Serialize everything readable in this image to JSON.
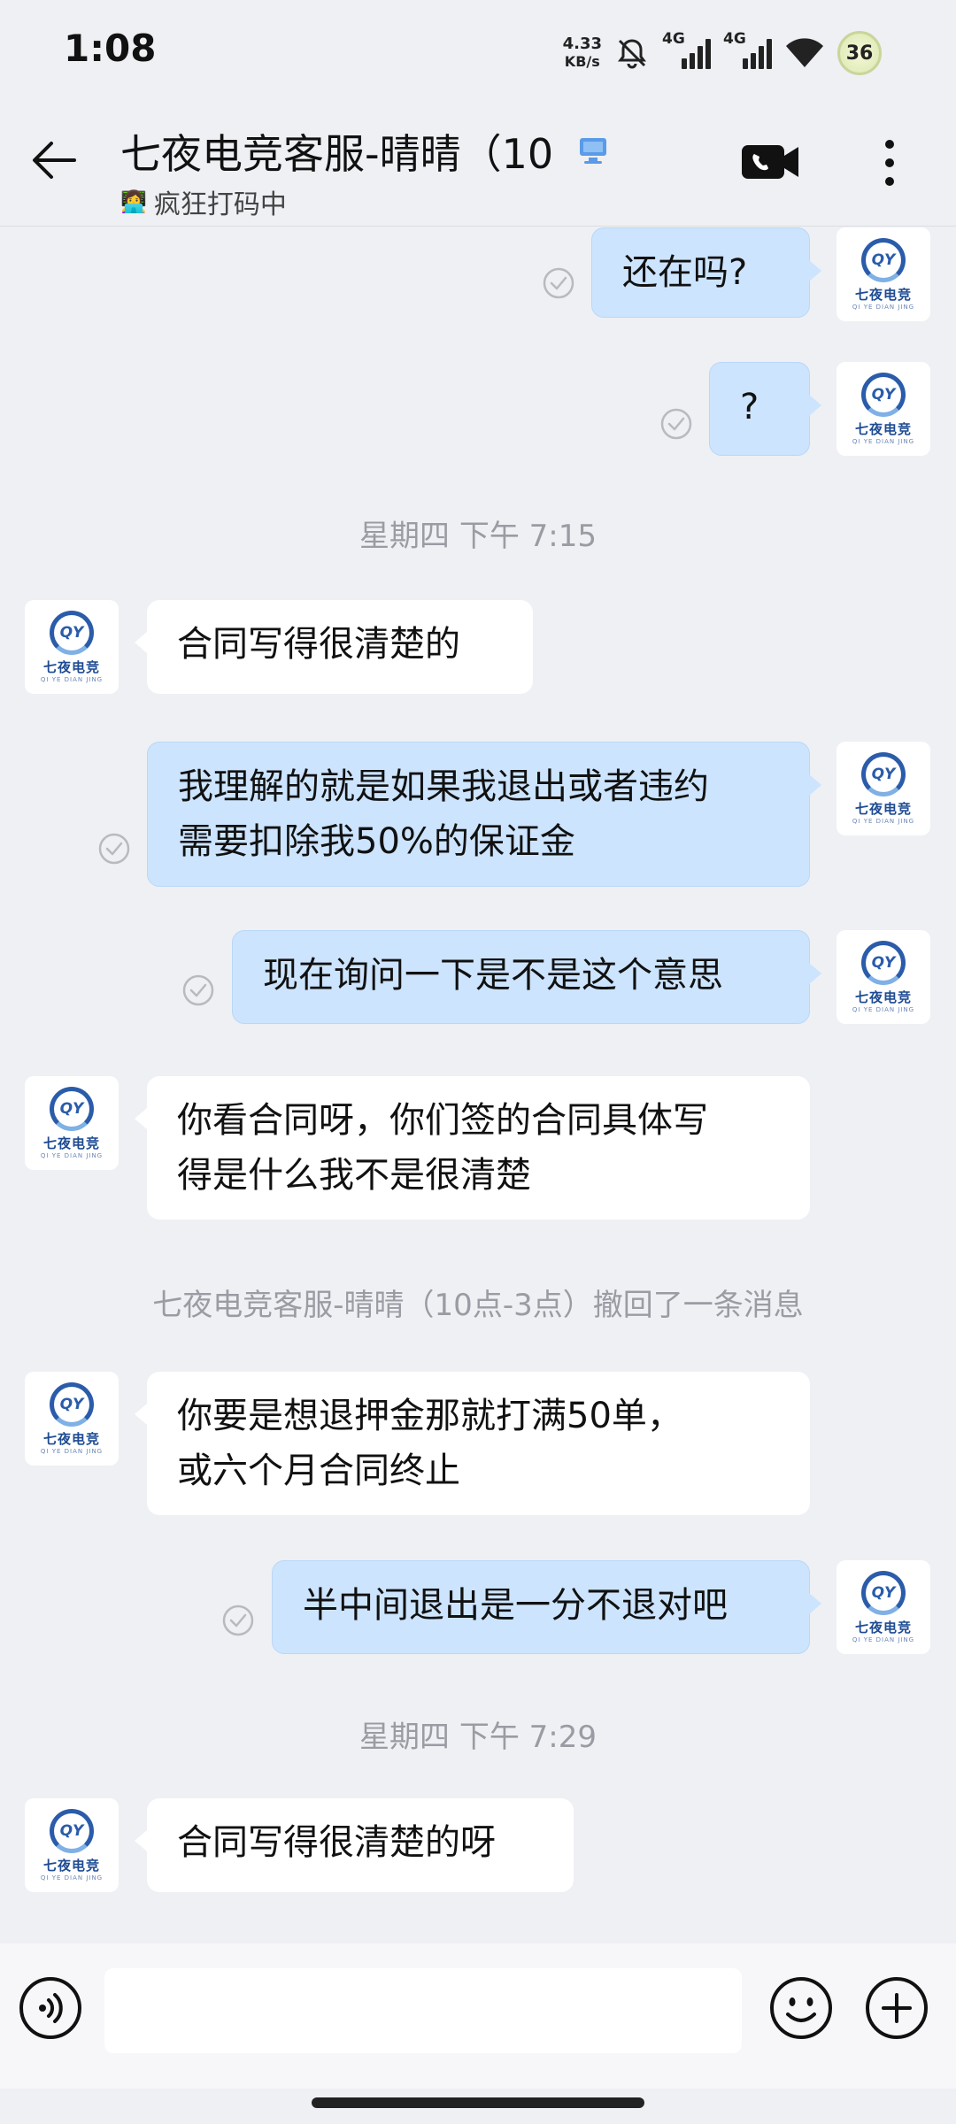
{
  "status_bar": {
    "time": "1:08",
    "net_speed_value": "4.33",
    "net_speed_unit": "KB/s",
    "sim1_label": "4G",
    "sim2_label": "4G",
    "battery": "36"
  },
  "header": {
    "title": "七夜电竞客服-晴晴（10",
    "status_emoji": "👩‍💻",
    "status_text": "疯狂打码中"
  },
  "messages": [
    {
      "side": "out",
      "text": "还在吗?"
    },
    {
      "side": "out",
      "text": "?"
    },
    {
      "side": "time",
      "text": "星期四  下午 7:15"
    },
    {
      "side": "in",
      "text": "合同写得很清楚的"
    },
    {
      "side": "out",
      "text": "我理解的就是如果我退出或者违约\n需要扣除我50%的保证金"
    },
    {
      "side": "out",
      "text": "现在询问一下是不是这个意思"
    },
    {
      "side": "in",
      "text": "你看合同呀，你们签的合同具体写\n得是什么我不是很清楚"
    },
    {
      "side": "notice",
      "text": "七夜电竞客服-晴晴（10点-3点）撤回了一条消息"
    },
    {
      "side": "in",
      "text": "你要是想退押金那就打满50单，\n或六个月合同终止"
    },
    {
      "side": "out",
      "text": "半中间退出是一分不退对吧"
    },
    {
      "side": "time",
      "text": "星期四  下午 7:29"
    },
    {
      "side": "in",
      "text": "合同写得很清楚的呀"
    }
  ],
  "avatar": {
    "logo_text": "QY",
    "name": "七夜电竞",
    "sub": "QI YE DIAN JING"
  },
  "input": {
    "placeholder": ""
  },
  "colors": {
    "background": "#eef0f4",
    "outgoing_bubble": "#cce4fd",
    "incoming_bubble": "#ffffff",
    "meta_text": "#9a9ca3"
  }
}
